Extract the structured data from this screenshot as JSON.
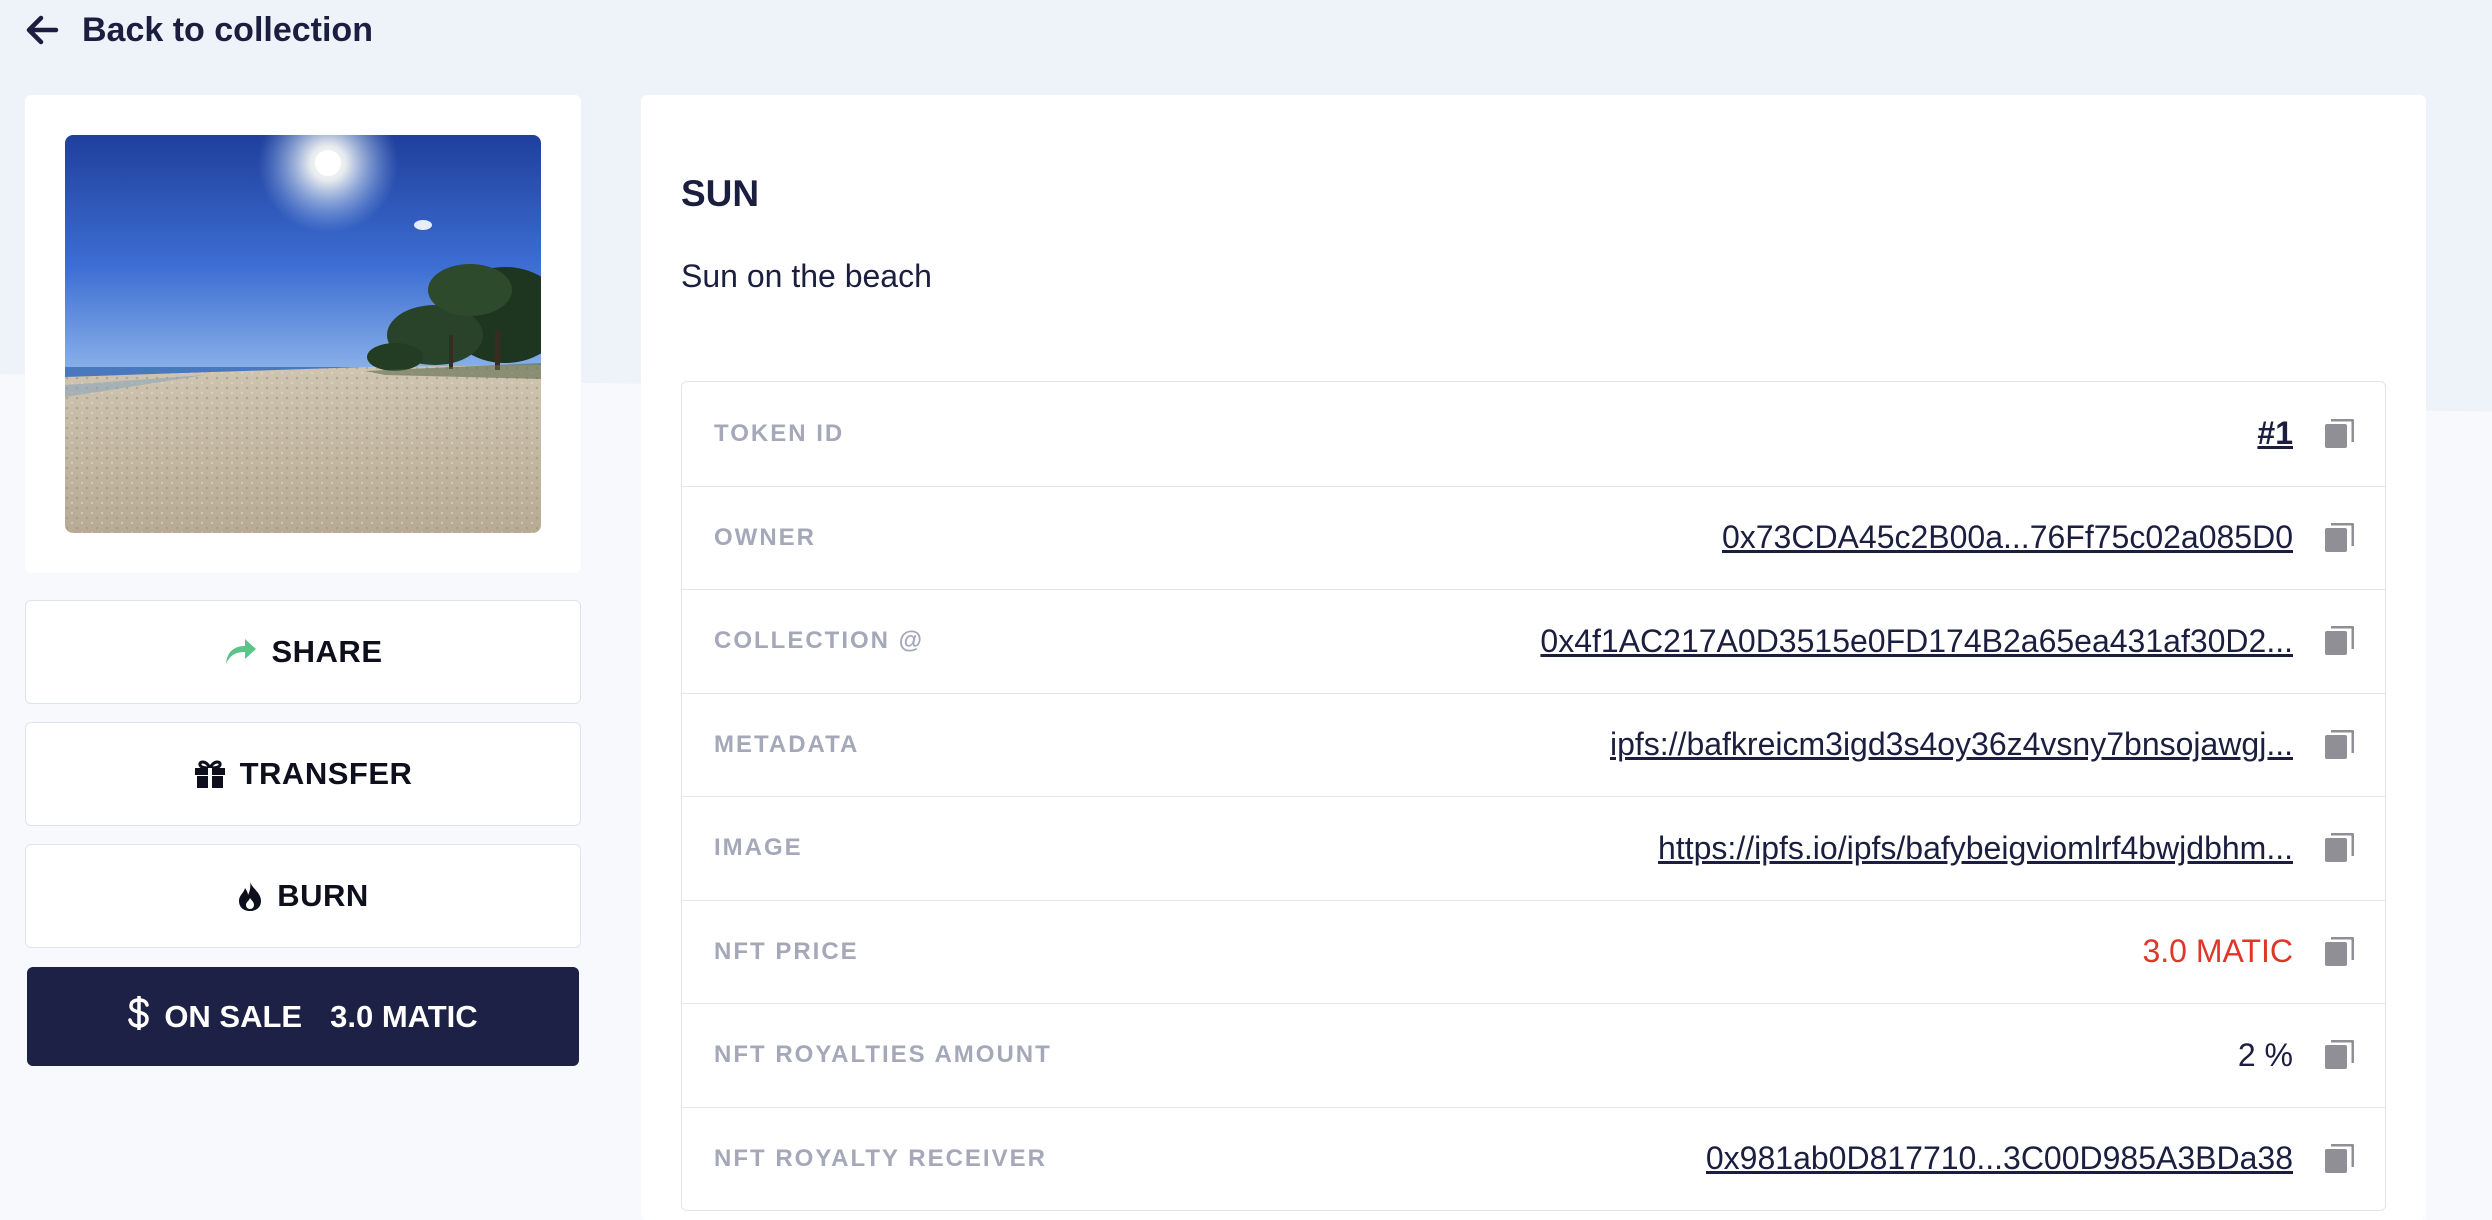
{
  "nav": {
    "back_label": "Back to collection"
  },
  "nft": {
    "title": "SUN",
    "description": "Sun on the beach"
  },
  "actions": {
    "share_label": "SHARE",
    "transfer_label": "TRANSFER",
    "burn_label": "BURN",
    "sale_label": "ON SALE",
    "sale_price": "3.0 MATIC"
  },
  "details": [
    {
      "label": "TOKEN ID",
      "value": "#1"
    },
    {
      "label": "OWNER",
      "value": "0x73CDA45c2B00a...76Ff75c02a085D0"
    },
    {
      "label": "COLLECTION @",
      "value": "0x4f1AC217A0D3515e0FD174B2a65ea431af30D2..."
    },
    {
      "label": "METADATA",
      "value": "ipfs://bafkreicm3igd3s4oy36z4vsny7bnsojawgj..."
    },
    {
      "label": "IMAGE",
      "value": "https://ipfs.io/ipfs/bafybeigviomlrf4bwjdbhm..."
    },
    {
      "label": "NFT PRICE",
      "value": "3.0 MATIC"
    },
    {
      "label": "NFT ROYALTIES AMOUNT",
      "value": "2 %"
    },
    {
      "label": "NFT ROYALTY RECEIVER",
      "value": "0x981ab0D817710...3C00D985A3BDa38"
    }
  ],
  "colors": {
    "background": "#eef2f9",
    "primary_dark": "#1c2145",
    "price_red": "#e0362a",
    "share_green": "#5dc489",
    "label_gray": "#a4a8b8"
  },
  "icons": {
    "back": "arrow-left-icon",
    "share": "share-arrow-icon",
    "transfer": "gift-icon",
    "burn": "flame-icon",
    "sale": "dollar-icon",
    "copy": "copy-icon"
  }
}
